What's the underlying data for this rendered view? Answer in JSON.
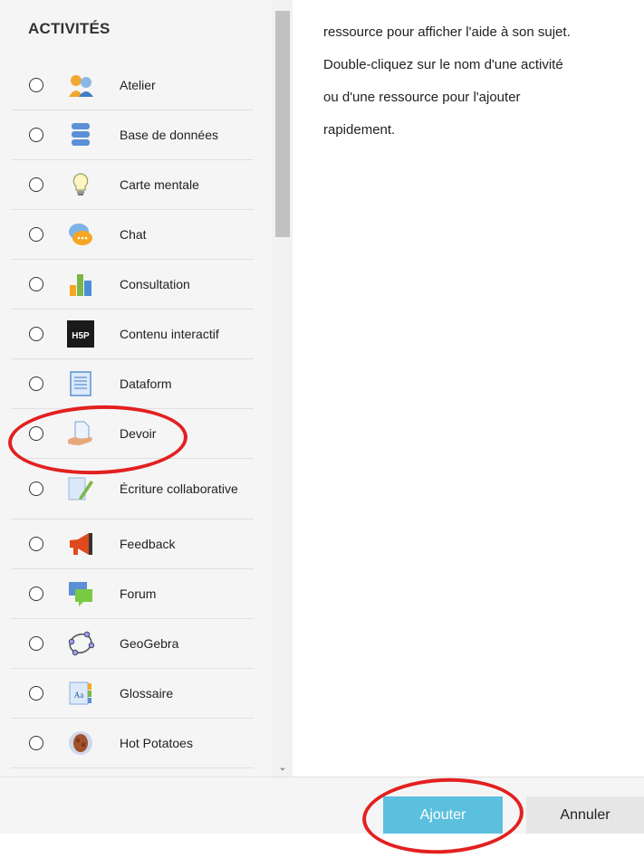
{
  "section_title": "ACTIVITÉS",
  "activities": [
    {
      "label": "Atelier",
      "icon": "workshop-icon"
    },
    {
      "label": "Base de données",
      "icon": "database-icon"
    },
    {
      "label": "Carte mentale",
      "icon": "lightbulb-icon"
    },
    {
      "label": "Chat",
      "icon": "chat-icon"
    },
    {
      "label": "Consultation",
      "icon": "bar-chart-icon"
    },
    {
      "label": "Contenu interactif",
      "icon": "h5p-icon",
      "icon_text": "H5P"
    },
    {
      "label": "Dataform",
      "icon": "form-icon"
    },
    {
      "label": "Devoir",
      "icon": "assignment-icon"
    },
    {
      "label": "Écriture collaborative",
      "icon": "collaborative-writing-icon"
    },
    {
      "label": "Feedback",
      "icon": "megaphone-icon"
    },
    {
      "label": "Forum",
      "icon": "forum-icon"
    },
    {
      "label": "GeoGebra",
      "icon": "geogebra-icon"
    },
    {
      "label": "Glossaire",
      "icon": "glossary-icon",
      "icon_text": "Aa"
    },
    {
      "label": "Hot Potatoes",
      "icon": "hot-potatoes-icon"
    }
  ],
  "help_lines": [
    "ressource pour afficher l'aide à son sujet.",
    "Double-cliquez sur le nom d'une activité",
    "ou d'une ressource pour l'ajouter",
    "rapidement."
  ],
  "buttons": {
    "add_label": "Ajouter",
    "cancel_label": "Annuler"
  },
  "colors": {
    "add_button": "#5bc0de",
    "cancel_button": "#e6e6e6",
    "annotation": "#e32020"
  }
}
